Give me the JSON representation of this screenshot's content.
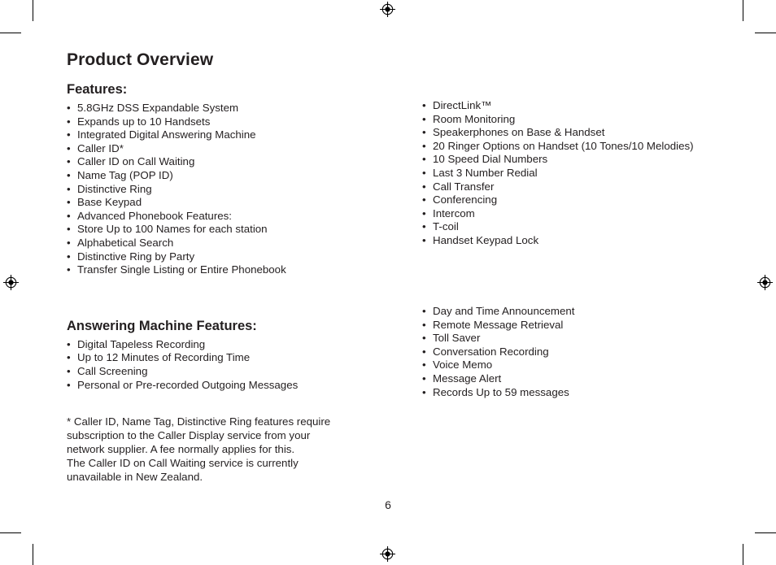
{
  "document": {
    "title": "Product Overview",
    "page_number": "6"
  },
  "features": {
    "heading": "Features:",
    "left_items": [
      {
        "level": 1,
        "text": "5.8GHz DSS Expandable System"
      },
      {
        "level": 1,
        "text": "Expands up to 10 Handsets"
      },
      {
        "level": 1,
        "text": "Integrated Digital Answering Machine"
      },
      {
        "level": 1,
        "text": "Caller ID*"
      },
      {
        "level": 2,
        "text": "Caller ID on Call Waiting"
      },
      {
        "level": 2,
        "text": "Name Tag (POP ID)"
      },
      {
        "level": 2,
        "text": "Distinctive Ring"
      },
      {
        "level": 1,
        "text": "Base Keypad"
      },
      {
        "level": 1,
        "text": "Advanced Phonebook Features:"
      },
      {
        "level": 2,
        "text": "Store Up to 100 Names for each station"
      },
      {
        "level": 2,
        "text": "Alphabetical Search"
      },
      {
        "level": 2,
        "text": "Distinctive Ring by Party"
      },
      {
        "level": 2,
        "text": "Transfer Single Listing or Entire Phonebook"
      }
    ],
    "right_items": [
      {
        "level": 1,
        "text": "DirectLink™"
      },
      {
        "level": 1,
        "text": "Room Monitoring"
      },
      {
        "level": 1,
        "text": "Speakerphones on Base & Handset"
      },
      {
        "level": 1,
        "text": "20 Ringer Options on Handset (10 Tones/10 Melodies)",
        "justify": true
      },
      {
        "level": 1,
        "text": "10 Speed Dial Numbers"
      },
      {
        "level": 1,
        "text": "Last 3 Number Redial"
      },
      {
        "level": 1,
        "text": "Call Transfer"
      },
      {
        "level": 1,
        "text": "Conferencing"
      },
      {
        "level": 1,
        "text": "Intercom"
      },
      {
        "level": 1,
        "text": "T-coil"
      },
      {
        "level": 1,
        "text": "Handset Keypad Lock"
      }
    ]
  },
  "answering_machine": {
    "heading": "Answering Machine Features:",
    "left_items": [
      {
        "level": 1,
        "text": "Digital Tapeless Recording"
      },
      {
        "level": 1,
        "text": "Up to 12 Minutes of Recording Time"
      },
      {
        "level": 1,
        "text": "Call Screening"
      },
      {
        "level": 1,
        "text": "Personal or Pre-recorded Outgoing Messages"
      }
    ],
    "right_items": [
      {
        "level": 1,
        "text": "Day and Time Announcement"
      },
      {
        "level": 1,
        "text": "Remote Message Retrieval"
      },
      {
        "level": 1,
        "text": "Toll Saver"
      },
      {
        "level": 1,
        "text": "Conversation Recording"
      },
      {
        "level": 1,
        "text": "Voice Memo"
      },
      {
        "level": 1,
        "text": "Message Alert"
      },
      {
        "level": 1,
        "text": "Records Up to 59 messages"
      }
    ]
  },
  "footnote": {
    "line1": "* Caller ID, Name Tag, Distinctive Ring features require",
    "line2": "subscription to the Caller Display service from your",
    "line3": "network supplier. A fee normally applies for this.",
    "line4": "The Caller ID on Call Waiting service is currently",
    "line5": "unavailable in New Zealand."
  },
  "print_marks": {
    "bullet_glyph": "•",
    "mark_color": "#000000",
    "text_color": "#231f20"
  }
}
